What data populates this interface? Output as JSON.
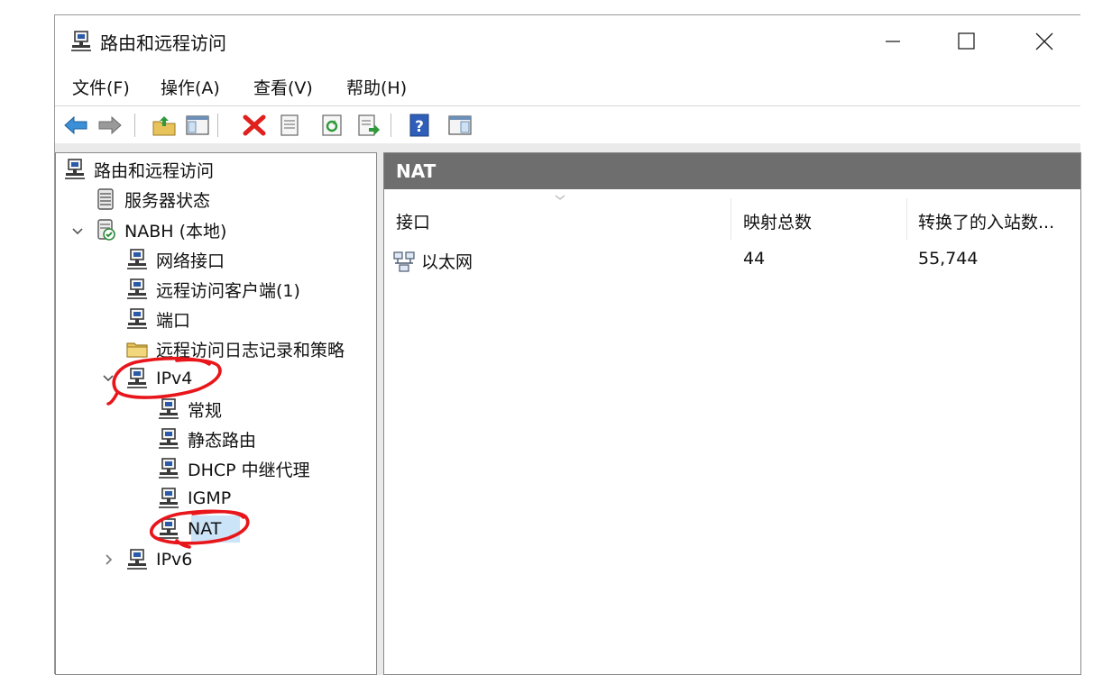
{
  "window": {
    "title": "路由和远程访问",
    "controls": {
      "minimize": "minimize",
      "maximize": "maximize",
      "close": "close"
    }
  },
  "menu": {
    "file": "文件(F)",
    "action": "操作(A)",
    "view": "查看(V)",
    "help": "帮助(H)"
  },
  "tree": {
    "root": "路由和远程访问",
    "server_status": "服务器状态",
    "server": "NABH (本地)",
    "network_interfaces": "网络接口",
    "remote_clients": "远程访问客户端(1)",
    "ports": "端口",
    "remote_logging": "远程访问日志记录和策略",
    "ipv4": "IPv4",
    "general": "常规",
    "static_routes": "静态路由",
    "dhcp_relay": "DHCP 中继代理",
    "igmp": "IGMP",
    "nat": "NAT",
    "ipv6": "IPv6"
  },
  "right_pane": {
    "header": "NAT",
    "columns": [
      "接口",
      "映射总数",
      "转换了的入站数..."
    ],
    "rows": [
      {
        "interface": "以太网",
        "total_mappings": "44",
        "inbound_translated": "55,744"
      }
    ]
  },
  "colors": {
    "selection": "#cce4f7",
    "pane_header": "#6e6e6e",
    "annotation": "#e8161b"
  },
  "icons": {
    "back": "back-arrow-icon",
    "forward": "forward-arrow-icon",
    "up": "up-folder-icon",
    "show_tree": "show-hide-tree-icon",
    "delete": "delete-x-icon",
    "properties": "properties-icon",
    "refresh": "refresh-icon",
    "export": "export-list-icon",
    "help": "help-icon",
    "action_pane": "action-pane-icon"
  }
}
